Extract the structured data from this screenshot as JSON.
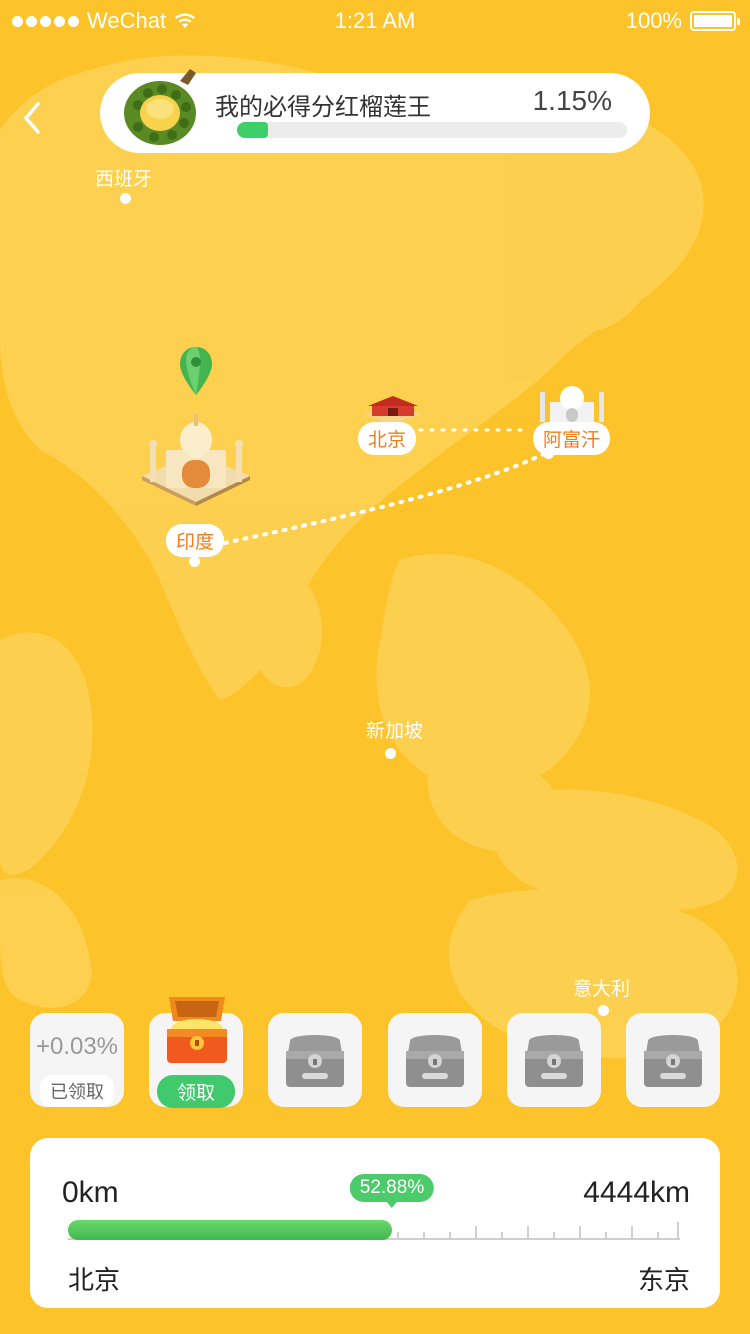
{
  "status_bar": {
    "carrier": "WeChat",
    "time": "1:21 AM",
    "battery": "100%"
  },
  "header": {
    "title": "我的必得分红榴莲王",
    "percent": "1.15%",
    "progress": 0.08
  },
  "map": {
    "cities": {
      "spain": "西班牙",
      "beijing": "北京",
      "afghanistan": "阿富汗",
      "india": "印度",
      "singapore": "新加坡",
      "italy": "意大利"
    }
  },
  "rewards": [
    {
      "amount": "+0.03%",
      "status": "已领取"
    },
    {
      "status": "领取"
    },
    {
      "status": "locked"
    },
    {
      "status": "locked"
    },
    {
      "status": "locked"
    },
    {
      "status": "locked"
    }
  ],
  "distance": {
    "start": "0km",
    "end": "4444km",
    "percent_label": "52.88%",
    "progress": 0.5288,
    "from_city": "北京",
    "to_city": "东京"
  },
  "colors": {
    "background": "#FCC32A",
    "accent_green": "#3ECF6A",
    "tag_orange": "#F07D1A"
  }
}
